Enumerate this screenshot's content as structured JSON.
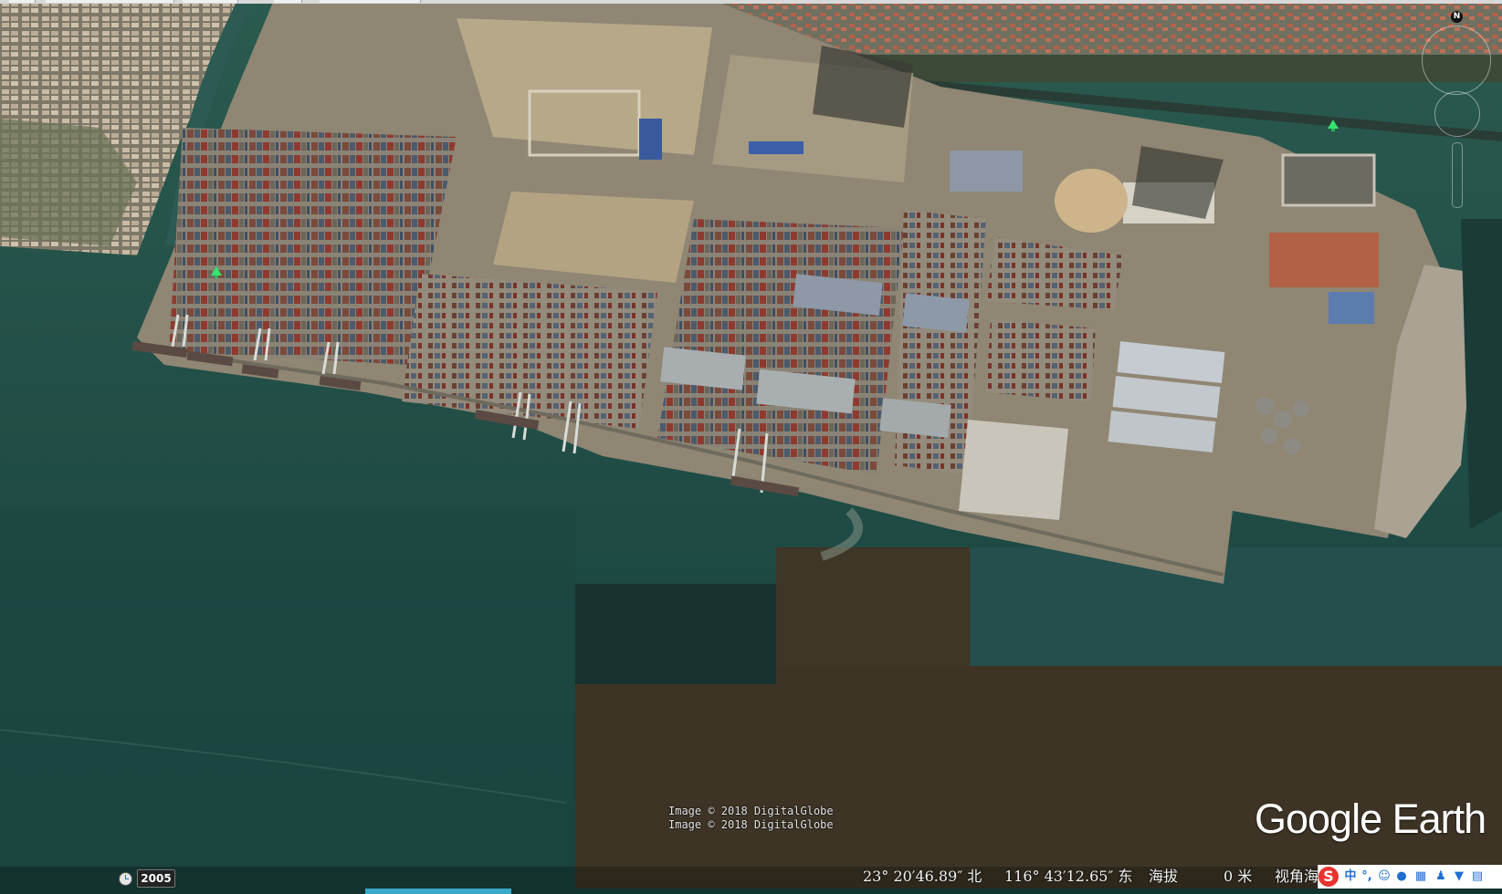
{
  "map": {
    "type": "satellite-imagery",
    "subject": "container port terminal along river shore",
    "placemark_icon": "green-placemark-icon"
  },
  "imagery": {
    "credit_line_1": "Image © 2018 DigitalGlobe",
    "credit_line_2": "Image © 2018 DigitalGlobe"
  },
  "logo": {
    "text": "Google Earth"
  },
  "navigation": {
    "north_label": "N",
    "compass_icon": "compass-ring-icon",
    "zoom_icon": "zoom-slider-icon"
  },
  "status_bar": {
    "historical_imagery_icon": "clock-icon",
    "imagery_year": "2005",
    "latitude": "23° 20′46.89″ 北",
    "longitude": "116° 43′12.65″ 东",
    "elevation_label": "海拔",
    "elevation_value": "0 米",
    "eye_alt_label": "视角海"
  },
  "ime_toolbar": {
    "logo": "S",
    "mode": "中",
    "punctuation": "°,",
    "icons": [
      "smiley-icon",
      "microphone-icon",
      "keyboard-icon",
      "user-icon",
      "shirt-icon",
      "grid-icon"
    ]
  },
  "colors": {
    "water_green": "#1e4a45",
    "water_brown": "#403527",
    "land": "#8c8474",
    "placemark": "#35e36d",
    "ime_red": "#e8332e",
    "ime_blue": "#1f6fd1"
  }
}
